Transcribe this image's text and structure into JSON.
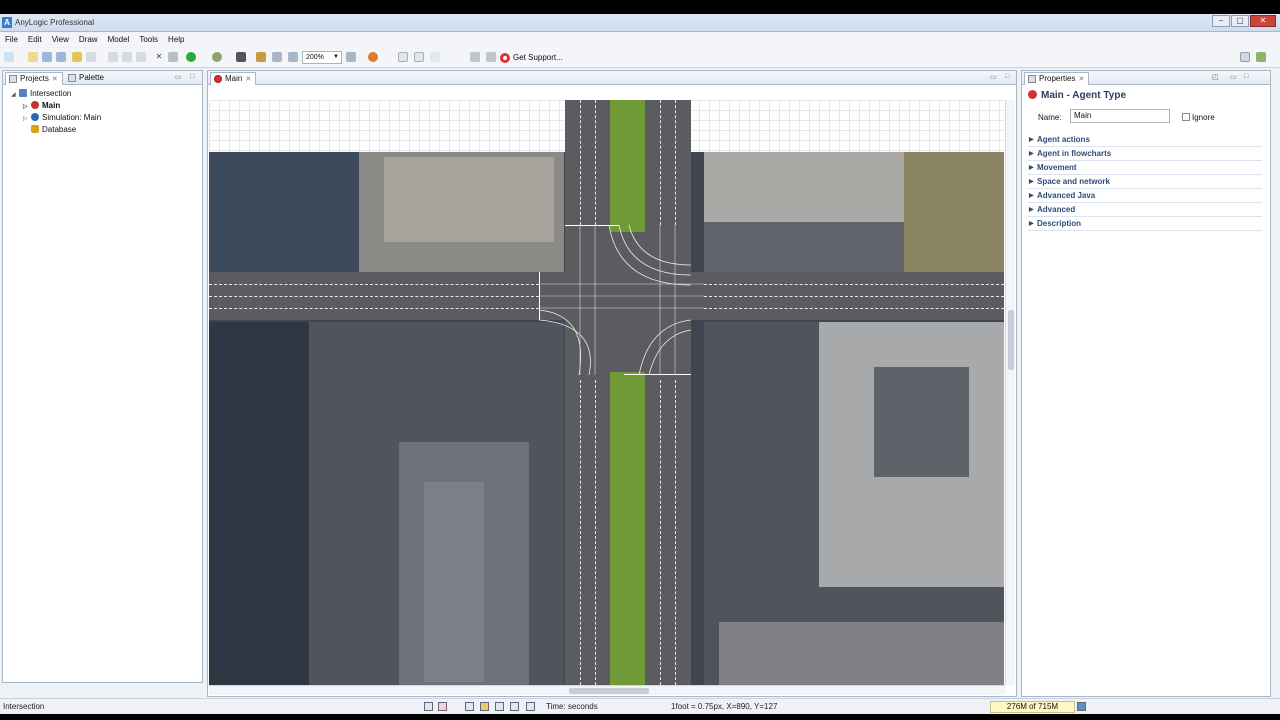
{
  "window": {
    "title": "AnyLogic Professional",
    "controls": [
      "–",
      "▢",
      "✕"
    ]
  },
  "menu": [
    "File",
    "Edit",
    "View",
    "Draw",
    "Model",
    "Tools",
    "Help"
  ],
  "toolbar": {
    "zoom": "200%",
    "support_label": "Get Support..."
  },
  "projects": {
    "tabs": [
      {
        "label": "Projects"
      },
      {
        "label": "Palette"
      }
    ],
    "tree": [
      {
        "label": "Intersection",
        "level": 0,
        "icon": "model-icon",
        "color": "#5a7fbf"
      },
      {
        "label": "Main",
        "level": 1,
        "icon": "agent-icon",
        "color": "#c33333",
        "bold": true
      },
      {
        "label": "Simulation: Main",
        "level": 1,
        "icon": "simulation-icon",
        "color": "#2f63b5"
      },
      {
        "label": "Database",
        "level": 1,
        "icon": "database-icon",
        "color": "#d6a21a"
      }
    ]
  },
  "editor": {
    "tab": "Main"
  },
  "properties": {
    "tab": "Properties",
    "title": "Main - Agent Type",
    "name_label": "Name:",
    "name_value": "Main",
    "ignore_label": "Ignore",
    "sections": [
      "Agent actions",
      "Agent in flowcharts",
      "Movement",
      "Space and network",
      "Advanced Java",
      "Advanced",
      "Description"
    ]
  },
  "status": {
    "left": "Intersection",
    "time": "Time: seconds",
    "coords": "1foot = 0.75px, X=890, Y=127",
    "memory": "276M of 715M"
  }
}
